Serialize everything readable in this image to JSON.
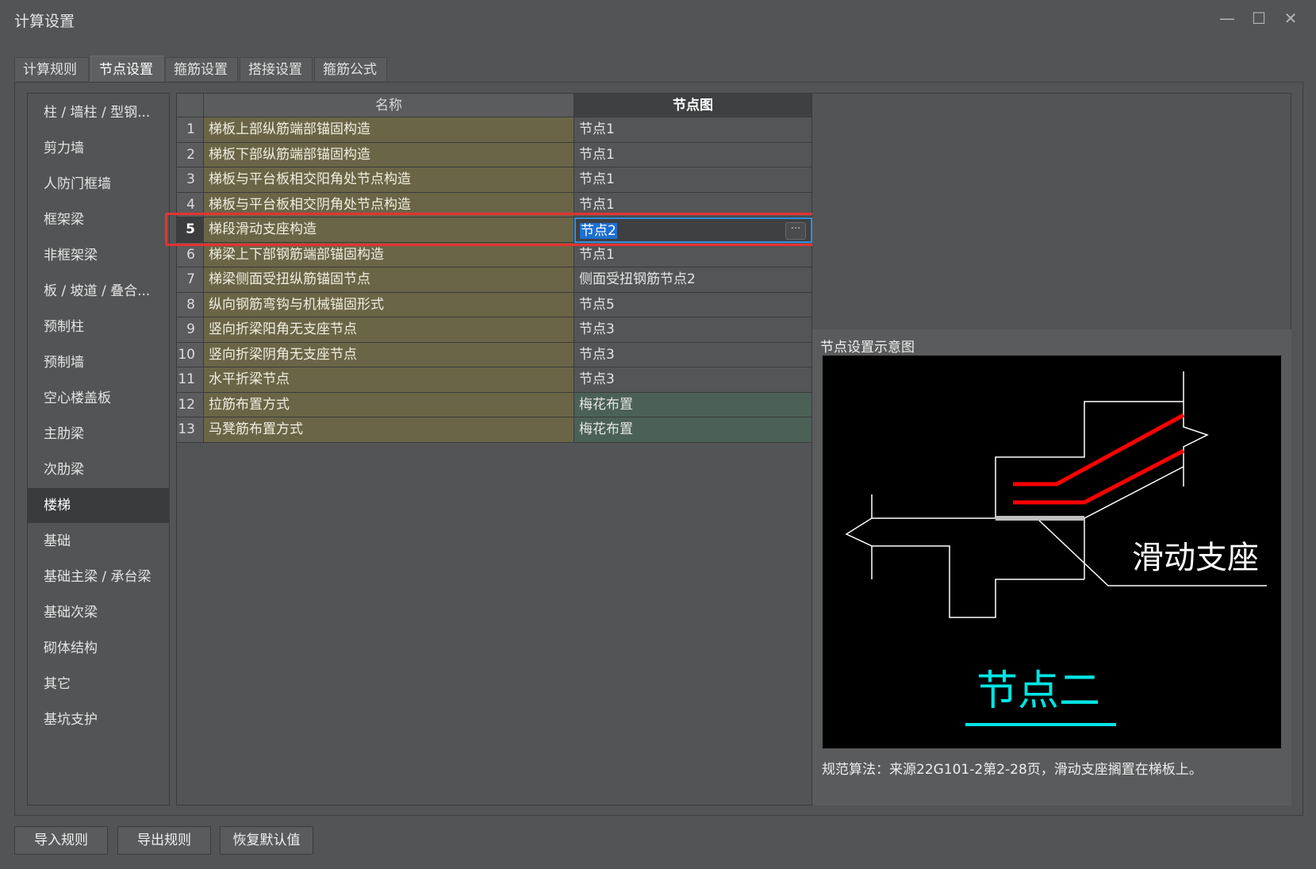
{
  "window": {
    "title": "计算设置"
  },
  "tabs": [
    {
      "label": "计算规则"
    },
    {
      "label": "节点设置"
    },
    {
      "label": "箍筋设置"
    },
    {
      "label": "搭接设置"
    },
    {
      "label": "箍筋公式"
    }
  ],
  "active_tab": "节点设置",
  "sidebar": {
    "items": [
      {
        "label": "柱 / 墙柱 / 型钢..."
      },
      {
        "label": "剪力墙"
      },
      {
        "label": "人防门框墙"
      },
      {
        "label": "框架梁"
      },
      {
        "label": "非框架梁"
      },
      {
        "label": "板 / 坡道 / 叠合..."
      },
      {
        "label": "预制柱"
      },
      {
        "label": "预制墙"
      },
      {
        "label": "空心楼盖板"
      },
      {
        "label": "主肋梁"
      },
      {
        "label": "次肋梁"
      },
      {
        "label": "楼梯"
      },
      {
        "label": "基础"
      },
      {
        "label": "基础主梁 / 承台梁"
      },
      {
        "label": "基础次梁"
      },
      {
        "label": "砌体结构"
      },
      {
        "label": "其它"
      },
      {
        "label": "基坑支护"
      }
    ],
    "active": "楼梯"
  },
  "grid": {
    "headers": {
      "name": "名称",
      "node": "节点图"
    },
    "rows": [
      {
        "idx": "1",
        "name": "梯板上部纵筋端部锚固构造",
        "node": "节点1"
      },
      {
        "idx": "2",
        "name": "梯板下部纵筋端部锚固构造",
        "node": "节点1"
      },
      {
        "idx": "3",
        "name": "梯板与平台板相交阳角处节点构造",
        "node": "节点1"
      },
      {
        "idx": "4",
        "name": "梯板与平台板相交阴角处节点构造",
        "node": "节点1"
      },
      {
        "idx": "5",
        "name": "梯段滑动支座构造",
        "node": "节点2"
      },
      {
        "idx": "6",
        "name": "梯梁上下部钢筋端部锚固构造",
        "node": "节点1"
      },
      {
        "idx": "7",
        "name": "梯梁侧面受扭纵筋锚固节点",
        "node": "侧面受扭钢筋节点2"
      },
      {
        "idx": "8",
        "name": "纵向钢筋弯钩与机械锚固形式",
        "node": "节点5"
      },
      {
        "idx": "9",
        "name": "竖向折梁阳角无支座节点",
        "node": "节点3"
      },
      {
        "idx": "10",
        "name": "竖向折梁阴角无支座节点",
        "node": "节点3"
      },
      {
        "idx": "11",
        "name": "水平折梁节点",
        "node": "节点3"
      },
      {
        "idx": "12",
        "name": "拉筋布置方式",
        "node": "梅花布置"
      },
      {
        "idx": "13",
        "name": "马凳筋布置方式",
        "node": "梅花布置"
      }
    ],
    "selected_row": "5",
    "more_button": "···"
  },
  "preview": {
    "label": "节点设置示意图",
    "diagram_text": "滑动支座",
    "diagram_title": "节点二",
    "description": "规范算法：来源22G101-2第2-28页，滑动支座搁置在梯板上。"
  },
  "footer": {
    "import": "导入规则",
    "export": "导出规则",
    "restore": "恢复默认值"
  },
  "icons": {
    "minimize": "minimize-icon",
    "maximize": "maximize-icon",
    "close": "close-icon"
  },
  "colors": {
    "highlight": "#e53232",
    "selection": "#1d6fd1",
    "rebar": "#ff0000",
    "title_cyan": "#00e5e5"
  }
}
